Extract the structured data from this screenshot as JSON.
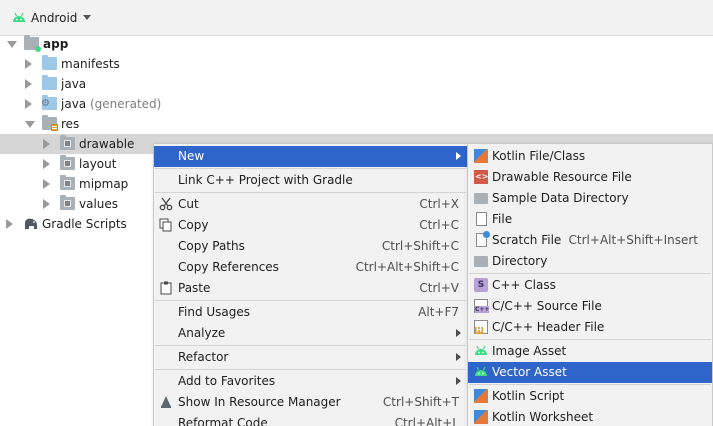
{
  "toolbar": {
    "title": "Android"
  },
  "tree": [
    {
      "label": "app",
      "gray": "",
      "indent": 0,
      "arrow": "down",
      "icon": "module",
      "bold": true
    },
    {
      "label": "manifests",
      "gray": "",
      "indent": 1,
      "arrow": "right",
      "icon": "folder-blue"
    },
    {
      "label": "java",
      "gray": "",
      "indent": 1,
      "arrow": "right",
      "icon": "folder-blue"
    },
    {
      "label": "java",
      "gray": "(generated)",
      "indent": 1,
      "arrow": "right",
      "icon": "folder-gen"
    },
    {
      "label": "res",
      "gray": "",
      "indent": 1,
      "arrow": "down",
      "icon": "folder-res"
    },
    {
      "label": "drawable",
      "gray": "",
      "indent": 2,
      "arrow": "right",
      "icon": "folder-gray",
      "selected": true
    },
    {
      "label": "layout",
      "gray": "",
      "indent": 2,
      "arrow": "right",
      "icon": "folder-gray"
    },
    {
      "label": "mipmap",
      "gray": "",
      "indent": 2,
      "arrow": "right",
      "icon": "folder-gray"
    },
    {
      "label": "values",
      "gray": "",
      "indent": 2,
      "arrow": "right",
      "icon": "folder-gray"
    },
    {
      "label": "Gradle Scripts",
      "gray": "",
      "indent": -1,
      "arrow": "right",
      "icon": "gradle"
    }
  ],
  "menu": {
    "items": [
      {
        "label": "New",
        "shortcut": "",
        "submenu": true,
        "highlight": true,
        "icon": ""
      },
      {
        "sep": true
      },
      {
        "label": "Link C++ Project with Gradle",
        "shortcut": "",
        "icon": ""
      },
      {
        "sep": true
      },
      {
        "label": "Cut",
        "shortcut": "Ctrl+X",
        "icon": "scissors"
      },
      {
        "label": "Copy",
        "shortcut": "Ctrl+C",
        "icon": "copy"
      },
      {
        "label": "Copy Paths",
        "shortcut": "Ctrl+Shift+C",
        "icon": ""
      },
      {
        "label": "Copy References",
        "shortcut": "Ctrl+Alt+Shift+C",
        "icon": ""
      },
      {
        "label": "Paste",
        "shortcut": "Ctrl+V",
        "icon": "paste"
      },
      {
        "sep": true
      },
      {
        "label": "Find Usages",
        "shortcut": "Alt+F7",
        "icon": ""
      },
      {
        "label": "Analyze",
        "shortcut": "",
        "submenu": true,
        "icon": ""
      },
      {
        "sep": true
      },
      {
        "label": "Refactor",
        "shortcut": "",
        "submenu": true,
        "icon": ""
      },
      {
        "sep": true
      },
      {
        "label": "Add to Favorites",
        "shortcut": "",
        "submenu": true,
        "icon": ""
      },
      {
        "label": "Show In Resource Manager",
        "shortcut": "Ctrl+Shift+T",
        "icon": "resource"
      },
      {
        "label": "Reformat Code",
        "shortcut": "Ctrl+Alt+L",
        "icon": ""
      }
    ]
  },
  "submenu": {
    "items": [
      {
        "label": "Kotlin File/Class",
        "shortcut": "",
        "icon": "kotlin"
      },
      {
        "label": "Drawable Resource File",
        "shortcut": "",
        "icon": "drawable"
      },
      {
        "label": "Sample Data Directory",
        "shortcut": "",
        "icon": "folder"
      },
      {
        "label": "File",
        "shortcut": "",
        "icon": "file"
      },
      {
        "label": "Scratch File",
        "shortcut": "Ctrl+Alt+Shift+Insert",
        "icon": "scratch"
      },
      {
        "label": "Directory",
        "shortcut": "",
        "icon": "folder"
      },
      {
        "sep": true
      },
      {
        "label": "C++ Class",
        "shortcut": "",
        "icon": "cls",
        "glyph": "S"
      },
      {
        "label": "C/C++ Source File",
        "shortcut": "",
        "icon": "cpp"
      },
      {
        "label": "C/C++ Header File",
        "shortcut": "",
        "icon": "h"
      },
      {
        "sep": true
      },
      {
        "label": "Image Asset",
        "shortcut": "",
        "icon": "android"
      },
      {
        "label": "Vector Asset",
        "shortcut": "",
        "icon": "android",
        "highlight": true
      },
      {
        "sep": true
      },
      {
        "label": "Kotlin Script",
        "shortcut": "",
        "icon": "ks"
      },
      {
        "label": "Kotlin Worksheet",
        "shortcut": "",
        "icon": "kw"
      }
    ]
  },
  "colors": {
    "highlight": "#2f65ca",
    "android_green": "#3ddc84",
    "selected_row": "#d6d6d6"
  }
}
